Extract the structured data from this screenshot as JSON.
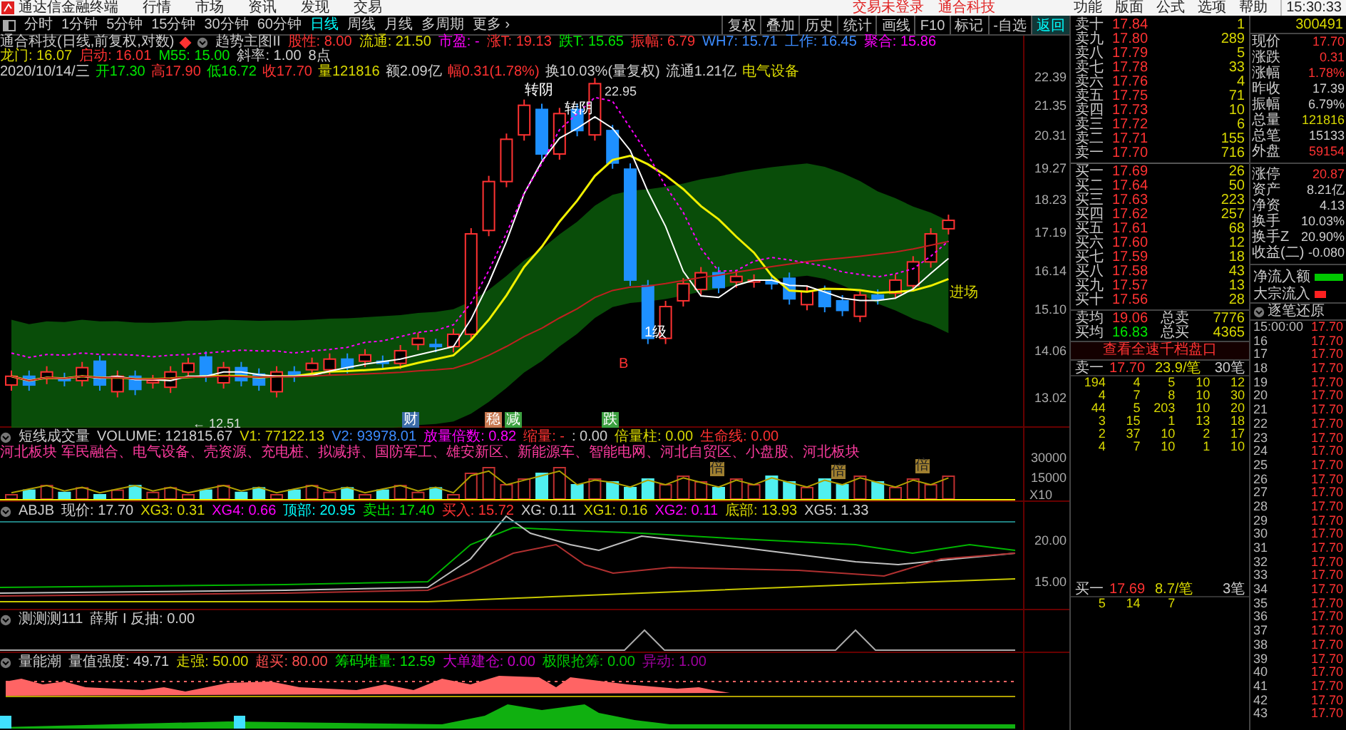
{
  "title_bar": {
    "app_name": "通达信金融终端",
    "menu": [
      "行情",
      "市场",
      "资讯",
      "发现",
      "交易"
    ],
    "status": [
      "交易未登录",
      "通合科技"
    ],
    "right_menu": [
      "功能",
      "版面",
      "公式",
      "选项",
      "帮助"
    ],
    "time": "15:30:33"
  },
  "period_tabs": [
    {
      "label": "分时",
      "selected": false
    },
    {
      "label": "1分钟",
      "selected": false
    },
    {
      "label": "5分钟",
      "selected": false
    },
    {
      "label": "15分钟",
      "selected": false
    },
    {
      "label": "30分钟",
      "selected": false
    },
    {
      "label": "60分钟",
      "selected": false
    },
    {
      "label": "日线",
      "selected": true
    },
    {
      "label": "周线",
      "selected": false
    },
    {
      "label": "月线",
      "selected": false
    },
    {
      "label": "多周期",
      "selected": false
    },
    {
      "label": "更多 ›",
      "selected": false
    }
  ],
  "toolbar": [
    {
      "label": "复权",
      "selected": false
    },
    {
      "label": "叠加",
      "selected": false
    },
    {
      "label": "历史",
      "selected": false
    },
    {
      "label": "统计",
      "selected": false
    },
    {
      "label": "画线",
      "selected": false
    },
    {
      "label": "F10",
      "selected": false
    },
    {
      "label": "标记",
      "selected": false
    },
    {
      "label": "-自选",
      "selected": false
    },
    {
      "label": "返回",
      "selected": true
    }
  ],
  "main_chart": {
    "title": "通合科技(日线,前复权,对数)",
    "indicator": "趋势主图II",
    "params": [
      {
        "text": "股性: 8.00",
        "color": "#ff3232"
      },
      {
        "text": "流通: 21.50",
        "color": "#d8d800"
      },
      {
        "text": "市盈: -",
        "color": "#ff00ff"
      },
      {
        "text": "涨T: 19.13",
        "color": "#ff3232"
      },
      {
        "text": "跌T: 15.65",
        "color": "#00e600"
      },
      {
        "text": "振幅: 6.79",
        "color": "#ff3232"
      },
      {
        "text": "WH7: 15.71",
        "color": "#3c8cff"
      },
      {
        "text": "工作: 16.45",
        "color": "#3c8cff"
      },
      {
        "text": "聚合: 15.86",
        "color": "#ff00ff"
      },
      {
        "text": "龙门: 16.07",
        "color": "#d8d800"
      },
      {
        "text": "启动: 16.01",
        "color": "#ff3232"
      },
      {
        "text": "M55: 15.00",
        "color": "#00e600"
      },
      {
        "text": "斜率: 1.00",
        "color": "#d0d0d0"
      },
      {
        "text": "8点",
        "color": "#d0d0d0"
      }
    ],
    "quote": [
      {
        "text": "2020/10/14/三",
        "color": "#d0d0d0"
      },
      {
        "text": "开17.30",
        "color": "#00e600"
      },
      {
        "text": "高17.90",
        "color": "#ff3232"
      },
      {
        "text": "低16.72",
        "color": "#00e600"
      },
      {
        "text": "收17.70",
        "color": "#ff3232"
      },
      {
        "text": "量121816",
        "color": "#d8d800"
      },
      {
        "text": "额2.09亿",
        "color": "#d0d0d0"
      },
      {
        "text": "幅0.31(1.78%)",
        "color": "#ff3232"
      },
      {
        "text": "换10.03%(量复权)",
        "color": "#d0d0d0"
      },
      {
        "text": "流通1.21亿",
        "color": "#d0d0d0"
      },
      {
        "text": "电气设备",
        "color": "#d8d800"
      }
    ],
    "y_axis": [
      "22.39",
      "21.35",
      "20.31",
      "19.27",
      "18.23",
      "17.19",
      "16.14",
      "15.10",
      "14.06",
      "13.02"
    ],
    "high_label": "22.95",
    "low_label": "← 12.51",
    "labels": [
      {
        "text": "转阴",
        "color": "#ffffff"
      },
      {
        "text": "转阴",
        "color": "#ffffff"
      },
      {
        "text": "1级",
        "color": "#ffffff"
      },
      {
        "text": "进场",
        "color": "#d8d800"
      },
      {
        "text": "B",
        "color": "#ff3232"
      }
    ],
    "markers": [
      {
        "text": "财",
        "color": "#3c6ca8"
      },
      {
        "text": "稳",
        "color": "#c87850"
      },
      {
        "text": "减",
        "color": "#3ca040"
      },
      {
        "text": "跌",
        "color": "#3ca040"
      }
    ]
  },
  "volume_panel": {
    "title": "短线成交量",
    "params": [
      {
        "text": "VOLUME: 121815.67",
        "color": "#d0d0d0"
      },
      {
        "text": "V1: 77122.13",
        "color": "#d8d800"
      },
      {
        "text": "V2: 93978.01",
        "color": "#3c8cff"
      },
      {
        "text": "放量倍数: 0.82",
        "color": "#ff00ff"
      },
      {
        "text": "缩量: -",
        "color": "#ff3232"
      },
      {
        "text": ": 0.00",
        "color": "#d0d0d0"
      },
      {
        "text": "倍量柱: 0.00",
        "color": "#d8d800"
      },
      {
        "text": "生命线: 0.00",
        "color": "#ff3232"
      }
    ],
    "sectors": "河北板块 军民融合、电气设备、壳资源、充电桩、拟减持、国防军工、雄安新区、新能源车、智能电网、河北自贸区、小盘股、河北板块",
    "bar_labels": [
      "倍",
      "倍",
      "倍"
    ],
    "y_axis": [
      "30000",
      "15000",
      "X10"
    ]
  },
  "abjb_panel": {
    "title": "ABJB",
    "params": [
      {
        "text": "现价: 17.70",
        "color": "#d0d0d0"
      },
      {
        "text": "XG3: 0.31",
        "color": "#d8d800"
      },
      {
        "text": "XG4: 0.66",
        "color": "#ff00ff"
      },
      {
        "text": "顶部: 20.95",
        "color": "#00ffff"
      },
      {
        "text": "卖出: 17.40",
        "color": "#00e600"
      },
      {
        "text": "买入: 15.72",
        "color": "#ff3232"
      },
      {
        "text": "XG: 0.11",
        "color": "#d0d0d0"
      },
      {
        "text": "XG1: 0.16",
        "color": "#d8d800"
      },
      {
        "text": "XG2: 0.11",
        "color": "#ff00ff"
      },
      {
        "text": "底部: 13.93",
        "color": "#d8d800"
      },
      {
        "text": "XG5: 1.33",
        "color": "#d0d0d0"
      }
    ],
    "y_axis": [
      "20.00",
      "15.00"
    ]
  },
  "test_panel": {
    "title": "测测测111",
    "params": [
      {
        "text": "薛斯 I 反抽: 0.00",
        "color": "#d0d0d0"
      }
    ]
  },
  "energy_panel": {
    "title": "量能潮",
    "params": [
      {
        "text": "量值强度: 49.71",
        "color": "#d0d0d0"
      },
      {
        "text": "走强: 50.00",
        "color": "#d8d800"
      },
      {
        "text": "超买: 80.00",
        "color": "#ff5050"
      },
      {
        "text": "筹码堆量: 12.59",
        "color": "#00e600"
      },
      {
        "text": "大单建仓: 0.00",
        "color": "#c800c8"
      },
      {
        "text": "极限抢筹: 0.00",
        "color": "#00c800"
      },
      {
        "text": "异动: 1.00",
        "color": "#a000a0"
      }
    ]
  },
  "order_book": {
    "asks": [
      {
        "label": "卖十",
        "price": "17.84",
        "volume": "1"
      },
      {
        "label": "卖九",
        "price": "17.80",
        "volume": "289"
      },
      {
        "label": "卖八",
        "price": "17.79",
        "volume": "5"
      },
      {
        "label": "卖七",
        "price": "17.78",
        "volume": "33"
      },
      {
        "label": "卖六",
        "price": "17.76",
        "volume": "4"
      },
      {
        "label": "卖五",
        "price": "17.75",
        "volume": "71"
      },
      {
        "label": "卖四",
        "price": "17.73",
        "volume": "10"
      },
      {
        "label": "卖三",
        "price": "17.72",
        "volume": "6"
      },
      {
        "label": "卖二",
        "price": "17.71",
        "volume": "155"
      },
      {
        "label": "卖一",
        "price": "17.70",
        "volume": "716"
      }
    ],
    "bids": [
      {
        "label": "买一",
        "price": "17.69",
        "volume": "26"
      },
      {
        "label": "买二",
        "price": "17.64",
        "volume": "50"
      },
      {
        "label": "买三",
        "price": "17.63",
        "volume": "223"
      },
      {
        "label": "买四",
        "price": "17.62",
        "volume": "257"
      },
      {
        "label": "买五",
        "price": "17.61",
        "volume": "68"
      },
      {
        "label": "买六",
        "price": "17.60",
        "volume": "12"
      },
      {
        "label": "买七",
        "price": "17.59",
        "volume": "18"
      },
      {
        "label": "买八",
        "price": "17.58",
        "volume": "43"
      },
      {
        "label": "买九",
        "price": "17.57",
        "volume": "13"
      },
      {
        "label": "买十",
        "price": "17.56",
        "volume": "28"
      }
    ],
    "summary": [
      {
        "label": "卖均",
        "price": "19.06",
        "color": "#ff3232",
        "total_label": "总卖",
        "total": "7776"
      },
      {
        "label": "买均",
        "price": "16.83",
        "color": "#00e600",
        "total_label": "总买",
        "total": "4365"
      }
    ],
    "depth_link": "查看全速千档盘口",
    "ask_queue": {
      "label": "卖一",
      "price": "17.70",
      "avg": "23.9/笔",
      "count": "30笔",
      "rows": [
        [
          "194",
          "4",
          "5",
          "10",
          "12"
        ],
        [
          "4",
          "7",
          "8",
          "10",
          "30"
        ],
        [
          "44",
          "5",
          "203",
          "10",
          "20"
        ],
        [
          "3",
          "15",
          "1",
          "13",
          "18"
        ],
        [
          "2",
          "37",
          "10",
          "2",
          "17"
        ],
        [
          "4",
          "7",
          "10",
          "1",
          "10"
        ]
      ]
    },
    "bid_queue": {
      "label": "买一",
      "price": "17.69",
      "avg": "8.7/笔",
      "count": "3笔",
      "rows": [
        [
          "5",
          "14",
          "7"
        ]
      ]
    }
  },
  "info": {
    "code": "300491",
    "stats": [
      {
        "label": "现价",
        "value": "17.70",
        "color": "#ff3232"
      },
      {
        "label": "涨跌",
        "value": "0.31",
        "color": "#ff3232"
      },
      {
        "label": "涨幅",
        "value": "1.78%",
        "color": "#ff3232"
      },
      {
        "label": "昨收",
        "value": "17.39",
        "color": "#d0d0d0"
      },
      {
        "label": "振幅",
        "value": "6.79%",
        "color": "#d0d0d0"
      },
      {
        "label": "总量",
        "value": "121816",
        "color": "#d8d800"
      },
      {
        "label": "总笔",
        "value": "15133",
        "color": "#d0d0d0"
      },
      {
        "label": "外盘",
        "value": "59154",
        "color": "#ff3232"
      }
    ],
    "stats2": [
      {
        "label": "涨停",
        "value": "20.87",
        "color": "#ff3232"
      },
      {
        "label": "资产",
        "value": "8.21亿",
        "color": "#d0d0d0"
      },
      {
        "label": "净资",
        "value": "4.13",
        "color": "#d0d0d0"
      },
      {
        "label": "换手",
        "value": "10.03%",
        "color": "#d0d0d0"
      },
      {
        "label": "换手Z",
        "value": "20.90%",
        "color": "#d0d0d0"
      },
      {
        "label": "收益(二)",
        "value": "-0.080",
        "color": "#d0d0d0"
      }
    ],
    "flows": [
      {
        "label": "净流入额",
        "color": "#00c800"
      },
      {
        "label": "大宗流入",
        "color": "#ff2020"
      }
    ],
    "ticks_title": "逐笔还原",
    "ticks": [
      {
        "time": "15:00:00",
        "price": "17.70"
      },
      {
        "time": "16",
        "price": "17.70"
      },
      {
        "time": "17",
        "price": "17.70"
      },
      {
        "time": "18",
        "price": "17.70"
      },
      {
        "time": "19",
        "price": "17.70"
      },
      {
        "time": "20",
        "price": "17.70"
      },
      {
        "time": "21",
        "price": "17.70"
      },
      {
        "time": "22",
        "price": "17.70"
      },
      {
        "time": "23",
        "price": "17.70"
      },
      {
        "time": "24",
        "price": "17.70"
      },
      {
        "time": "25",
        "price": "17.70"
      },
      {
        "time": "26",
        "price": "17.70"
      },
      {
        "time": "27",
        "price": "17.70"
      },
      {
        "time": "28",
        "price": "17.70"
      },
      {
        "time": "29",
        "price": "17.70"
      },
      {
        "time": "30",
        "price": "17.70"
      },
      {
        "time": "31",
        "price": "17.70"
      },
      {
        "time": "32",
        "price": "17.70"
      },
      {
        "time": "33",
        "price": "17.70"
      },
      {
        "time": "34",
        "price": "17.70"
      },
      {
        "time": "35",
        "price": "17.70"
      },
      {
        "time": "36",
        "price": "17.70"
      },
      {
        "time": "37",
        "price": "17.70"
      },
      {
        "time": "38",
        "price": "17.70"
      },
      {
        "time": "39",
        "price": "17.70"
      },
      {
        "time": "40",
        "price": "17.70"
      },
      {
        "time": "41",
        "price": "17.70"
      },
      {
        "time": "42",
        "price": "17.70"
      },
      {
        "time": "43",
        "price": "17.70"
      }
    ]
  }
}
